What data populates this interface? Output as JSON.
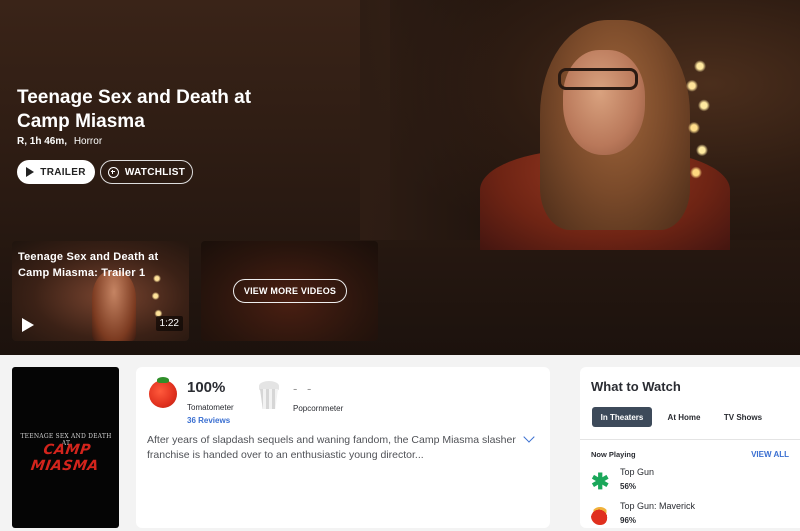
{
  "hero": {
    "title": "Teenage Sex and Death at Camp Miasma",
    "rating_runtime": "R, 1h 46m,",
    "genre": "Horror",
    "trailer_label": "TRAILER",
    "watchlist_label": "WATCHLIST"
  },
  "videos": [
    {
      "title": "Teenage Sex and Death at Camp Miasma: Trailer 1",
      "duration": "1:22"
    }
  ],
  "view_more_label": "VIEW MORE VIDEOS",
  "poster": {
    "top_text": "TEENAGE SEX AND DEATH AT",
    "main_text": "CAMP MIASMA"
  },
  "scores": {
    "tomatometer_value": "100%",
    "tomatometer_label": "Tomatometer",
    "reviews_link": "36 Reviews",
    "popcornmeter_value": "- -",
    "popcornmeter_label": "Popcornmeter",
    "synopsis": "After years of slapdash sequels and waning fandom, the Camp Miasma slasher franchise is handed over to an enthusiastic young director...",
    "tomato_icon": "fresh-tomato-icon",
    "popcorn_icon": "empty-popcorn-icon",
    "expand_icon": "chevron-down-icon"
  },
  "what_to_watch": {
    "title": "What to Watch",
    "tabs": [
      "In Theaters",
      "At Home",
      "TV Shows"
    ],
    "active_tab": "In Theaters",
    "section_label": "Now Playing",
    "view_all_label": "VIEW ALL",
    "items": [
      {
        "name": "Top Gun",
        "score": "56%",
        "icon": "splat-icon"
      },
      {
        "name": "Top Gun: Maverick",
        "score": "96%",
        "icon": "certified-fresh-icon"
      }
    ]
  },
  "colors": {
    "accent_blue": "#3a6fd1",
    "tab_active_bg": "#3d4a5a",
    "tomato_red": "#e0301e",
    "splat_green": "#1aa75a"
  }
}
